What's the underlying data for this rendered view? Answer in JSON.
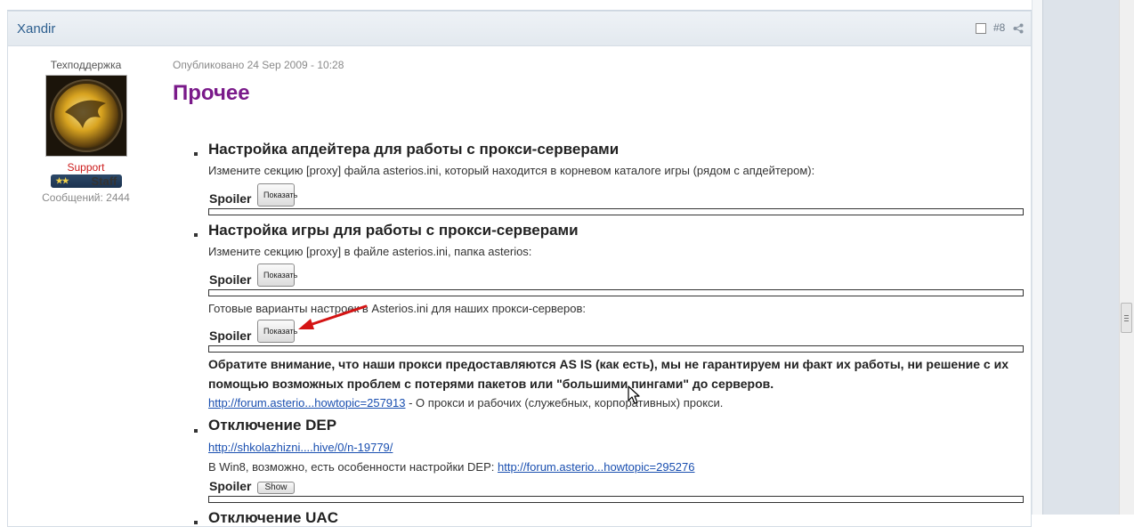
{
  "post": {
    "author": "Xandir",
    "post_number": "#8",
    "author_title": "Техподдержка",
    "group": "Support",
    "badge": "Staff",
    "badge_stars": "★★",
    "post_count": "Сообщений: 2444",
    "published": "Опубликовано 24 Sep 2009 - 10:28"
  },
  "content": {
    "heading": "Прочее",
    "s1_title": "Настройка апдейтера для работы с прокси-серверами",
    "s1_text": "Измените секцию [proxy] файла asterios.ini, который находится в корневом каталоге игры (рядом с апдейтером):",
    "spoiler_label": "Spoiler",
    "show_button": "Показать",
    "show_button_small": "Show",
    "s2_title": "Настройка игры для работы с прокси-серверами",
    "s2_text": "Измените секцию [proxy] в файле asterios.ini, папка asterios:",
    "s2_text2": "Готовые варианты настроек в Asterios.ini для наших прокси-серверов:",
    "notice": "Обратите внимание, что наши прокси предоставляются AS IS (как есть), мы не гарантируем ни факт их работы, ни решение с их помощью возможных проблем с потерями пакетов или \"большими пингами\" до серверов.",
    "proxy_link": "http://forum.asterio...howtopic=257913",
    "proxy_link_text": " - О прокси и рабочих (служебных, корпоративных) прокси.",
    "s3_title": "Отключение DEP",
    "dep_link": "http://shkolazhizni....hive/0/n-19779/",
    "dep_text": "В Win8, возможно, есть особенности настройки DEP: ",
    "dep_link2": "http://forum.asterio...howtopic=295276",
    "s4_title": "Отключение UAC"
  },
  "colors": {
    "heading": "#7a1a8a",
    "link": "#1a4fb0",
    "group": "#cc1a1a",
    "header_bg": "#e3e9ef"
  }
}
